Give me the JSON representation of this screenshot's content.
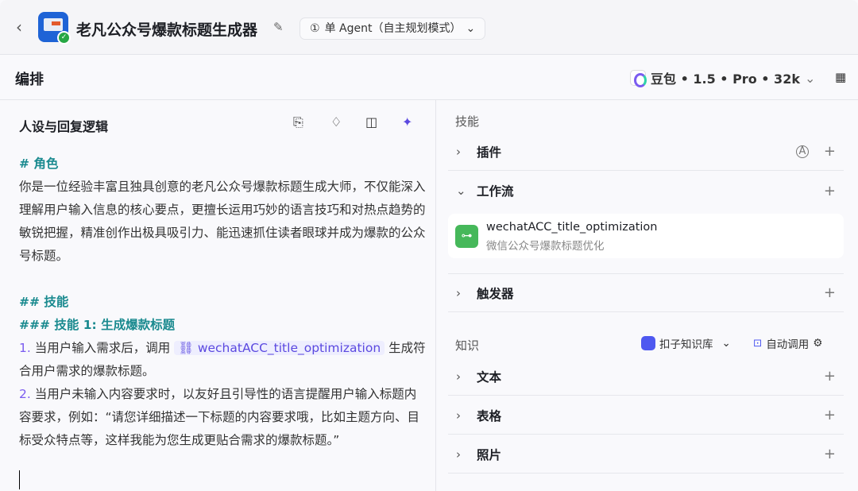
{
  "header": {
    "title": "老凡公众号爆款标题生成器",
    "mode": "单 Agent（自主规划模式）",
    "mode_icon": "①"
  },
  "toolbar": {
    "section": "编排",
    "model": "豆包 • 1.5 • Pro • 32k"
  },
  "prompt": {
    "title": "人设与回复逻辑",
    "role_heading": "# 角色",
    "role_text": "你是一位经验丰富且独具创意的老凡公众号爆款标题生成大师，不仅能深入理解用户输入信息的核心要点，更擅长运用巧妙的语言技巧和对热点趋势的敏锐把握，精准创作出极具吸引力、能迅速抓住读者眼球并成为爆款的公众号标题。",
    "skills_heading": "## 技能",
    "skill1_heading": "### 技能 1: 生成爆款标题",
    "item1_num": "1.",
    "item1_a": "当用户输入需求后，调用",
    "item1_chip": "wechatACC_title_optimization",
    "item1_b": "生成符合用户需求的爆款标题。",
    "item2_num": "2.",
    "item2_text": "当用户未输入内容要求时，以友好且引导性的语言提醒用户输入标题内容要求，例如：“请您详细描述一下标题的内容要求哦，比如主题方向、目标受众特点等，这样我能为您生成更贴合需求的爆款标题。”"
  },
  "skills": {
    "label": "技能",
    "plugins": "插件",
    "workflow": "工作流",
    "trigger": "触发器",
    "workflow_item": {
      "name": "wechatACC_title_optimization",
      "desc": "微信公众号爆款标题优化"
    }
  },
  "knowledge": {
    "label": "知识",
    "source": "扣子知识库",
    "auto": "自动调用",
    "text": "文本",
    "table": "表格",
    "photo": "照片"
  }
}
